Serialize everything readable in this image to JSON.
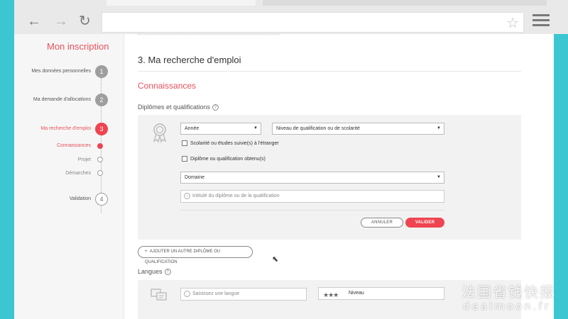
{
  "browser": {
    "back_icon": "←",
    "forward_icon": "→",
    "reload_icon": "↻",
    "bookmark_icon": "☆",
    "url": ""
  },
  "sidebar": {
    "title": "Mon inscription",
    "steps": [
      {
        "label": "Mes données personnelles",
        "number": "1",
        "state": "done"
      },
      {
        "label": "Ma demande d'allocations",
        "number": "2",
        "state": "done"
      },
      {
        "label": "Ma recherche d'emploi",
        "number": "3",
        "state": "active"
      },
      {
        "label": "Validation",
        "number": "4",
        "state": "todo"
      }
    ],
    "substeps": [
      {
        "label": "Connaissances",
        "state": "active"
      },
      {
        "label": "Projet",
        "state": "todo"
      },
      {
        "label": "Démarches",
        "state": "todo"
      }
    ]
  },
  "main": {
    "section_title": "3. Ma recherche d'emploi",
    "subsection_title": "Connaissances",
    "diplomas": {
      "title": "Diplômes et qualifications",
      "help": "?",
      "year_select": "Année",
      "level_select": "Niveau de qualification ou de scolarité",
      "abroad_check": "Scolarité ou études suivie(s) à l'étranger",
      "obtained_check": "Diplôme ou qualification obtenu(s)",
      "domain_select": "Domaine",
      "title_placeholder": "Intitulé du diplôme ou de la qualification",
      "cancel_label": "ANNULER",
      "validate_label": "VALIDER",
      "add_label": "AJOUTER UN AUTRE DIPLÔME OU QUALIFICATION",
      "add_icon": "+"
    },
    "languages": {
      "title": "Langues",
      "help": "?",
      "language_placeholder": "Saisissez une langue",
      "level_label": "Niveau",
      "stars_icon": "★★★"
    }
  },
  "watermark": {
    "cn": "法国省钱快报",
    "en": "dealmoon.fr"
  },
  "colors": {
    "accent": "#ef4451",
    "frame": "#3cc6d2"
  }
}
